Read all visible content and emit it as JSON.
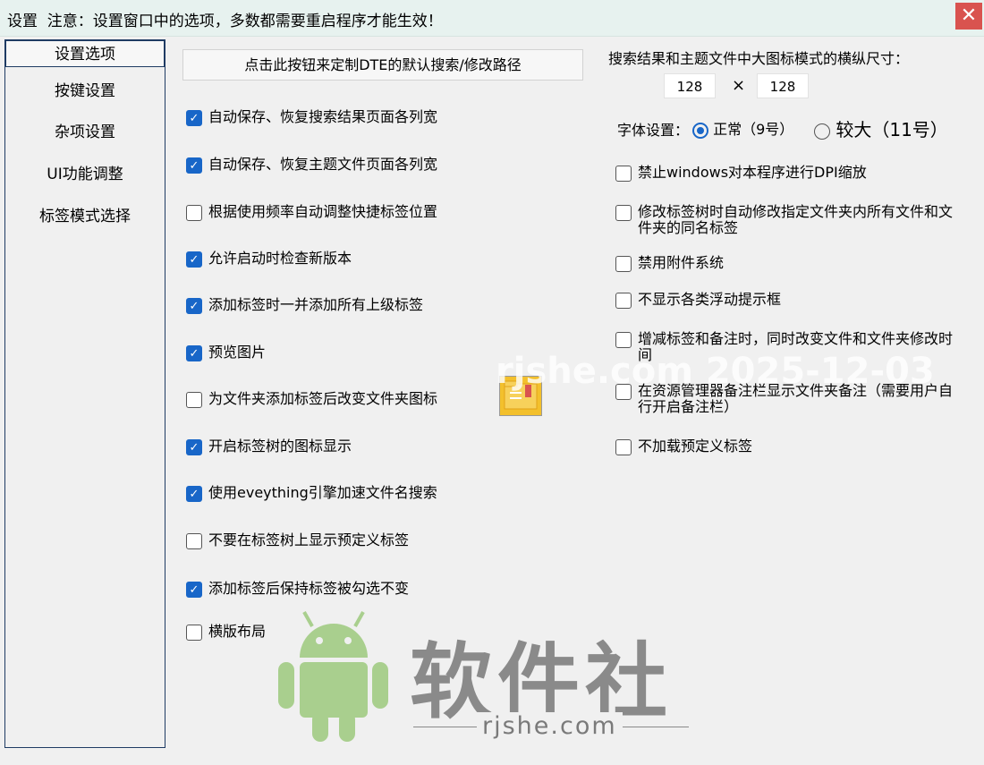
{
  "window": {
    "title": "设置  注意：设置窗口中的选项，多数都需要重启程序才能生效！",
    "close": "✕"
  },
  "sidebar": {
    "items": [
      "设置选项",
      "按键设置",
      "杂项设置",
      "UI功能调整",
      "标签模式选择"
    ]
  },
  "main_button": "点击此按钮来定制DTE的默认搜索/修改路径",
  "left_options": [
    {
      "label": "自动保存、恢复搜索结果页面各列宽",
      "checked": true
    },
    {
      "label": "自动保存、恢复主题文件页面各列宽",
      "checked": true
    },
    {
      "label": "根据使用频率自动调整快捷标签位置",
      "checked": false
    },
    {
      "label": "允许启动时检查新版本",
      "checked": true
    },
    {
      "label": "添加标签时一并添加所有上级标签",
      "checked": true
    },
    {
      "label": "预览图片",
      "checked": true
    },
    {
      "label": "为文件夹添加标签后改变文件夹图标",
      "checked": false
    },
    {
      "label": "开启标签树的图标显示",
      "checked": true
    },
    {
      "label": "使用eveything引擎加速文件名搜索",
      "checked": true
    },
    {
      "label": "不要在标签树上显示预定义标签",
      "checked": false
    },
    {
      "label": "添加标签后保持标签被勾选不变",
      "checked": true
    },
    {
      "label": "横版布局",
      "checked": false
    }
  ],
  "icon_size": {
    "label": "搜索结果和主题文件中大图标模式的横纵尺寸：",
    "width": "128",
    "times": "×",
    "height": "128"
  },
  "font": {
    "label": "字体设置：",
    "normal": "正常（9号）",
    "large": "较大（11号）",
    "selected": "normal"
  },
  "right_options": [
    {
      "label": "禁止windows对本程序进行DPI缩放",
      "checked": false
    },
    {
      "label": "修改标签树时自动修改指定文件夹内所有文件和文件夹的同名标签",
      "checked": false
    },
    {
      "label": "禁用附件系统",
      "checked": false
    },
    {
      "label": "不显示各类浮动提示框",
      "checked": false
    },
    {
      "label": "增减标签和备注时，同时改变文件和文件夹修改时间",
      "checked": false
    },
    {
      "label": "在资源管理器备注栏显示文件夹备注（需要用户自行开启备注栏）",
      "checked": false
    },
    {
      "label": "不加载预定义标签",
      "checked": false
    }
  ],
  "watermark": {
    "brand": "软件社",
    "domain": "rjshe.com",
    "stamp": "rjshe.com 2025-12-03"
  },
  "colors": {
    "accent": "#1866c8",
    "titlebar": "#e7f2ef",
    "close": "#d9534f",
    "border": "#1f3b63"
  }
}
